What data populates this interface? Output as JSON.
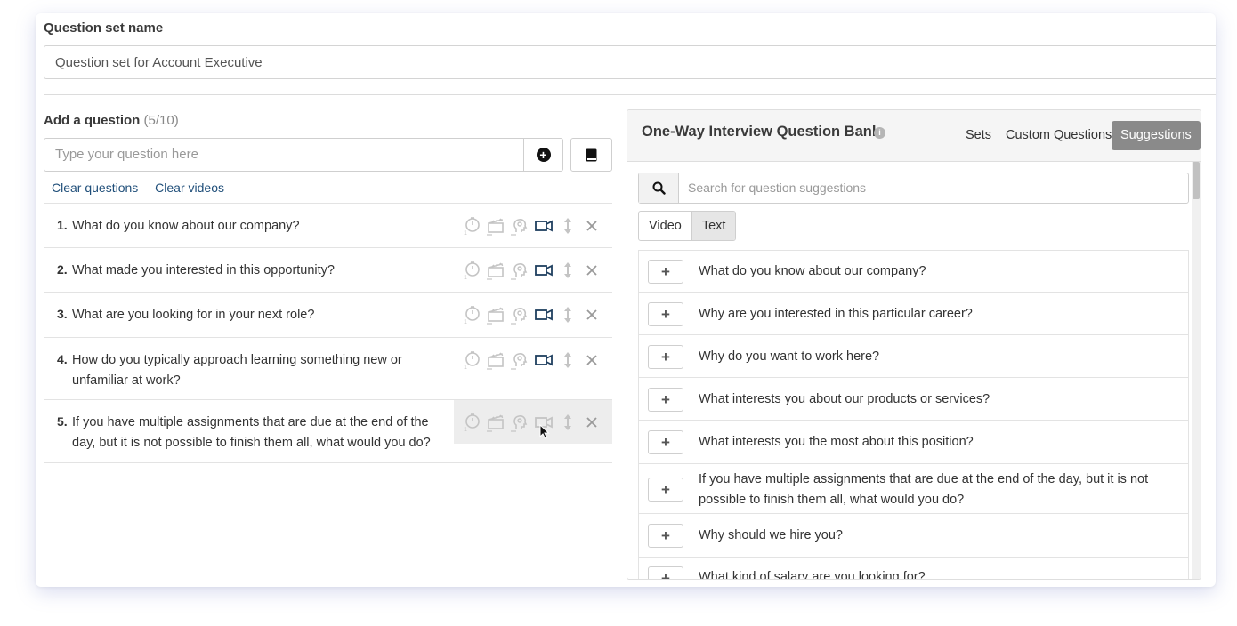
{
  "question_set": {
    "label": "Question set name",
    "value": "Question set for Account Executive"
  },
  "add_question": {
    "label": "Add a question",
    "count": "(5/10)",
    "placeholder": "Type your question here",
    "clear_questions": "Clear questions",
    "clear_videos": "Clear videos"
  },
  "questions": [
    {
      "num": "1.",
      "text": "What do you know about our company?"
    },
    {
      "num": "2.",
      "text": "What made you interested in this opportunity?"
    },
    {
      "num": "3.",
      "text": "What are you looking for in your next role?"
    },
    {
      "num": "4.",
      "text": "How do you typically approach learning something new or unfamiliar at work?"
    },
    {
      "num": "5.",
      "text": "If you have multiple assignments that are due at the end of the day, but it is not possible to finish them all, what would you do?"
    }
  ],
  "bank": {
    "title": "One-Way Interview Question Bank",
    "tabs": [
      "Sets",
      "Custom Questions",
      "Suggestions"
    ],
    "active_tab": "Suggestions",
    "search_placeholder": "Search for question suggestions",
    "type_toggle": [
      "Video",
      "Text"
    ],
    "active_type": "Text",
    "add_symbol": "+",
    "suggestions": [
      "What do you know about our company?",
      "Why are you interested in this particular career?",
      "Why do you want to work here?",
      "What interests you about our products or services?",
      "What interests you the most about this position?",
      "If you have multiple assignments that are due at the end of the day, but it is not possible to finish them all, what would you do?",
      "Why should we hire you?",
      "What kind of salary are you looking for?"
    ]
  },
  "colors": {
    "link": "#1f4e79",
    "video_icon_active": "#1f3f5f",
    "icon_muted": "#c4c4c4",
    "active_tab_bg": "#8a8a8a"
  },
  "icons": [
    "plus-circle-icon",
    "book-icon",
    "timer-icon",
    "clapperboard-icon",
    "head-icon",
    "video-camera-icon",
    "drag-handle-icon",
    "close-icon",
    "info-icon",
    "search-icon",
    "cursor-icon"
  ]
}
